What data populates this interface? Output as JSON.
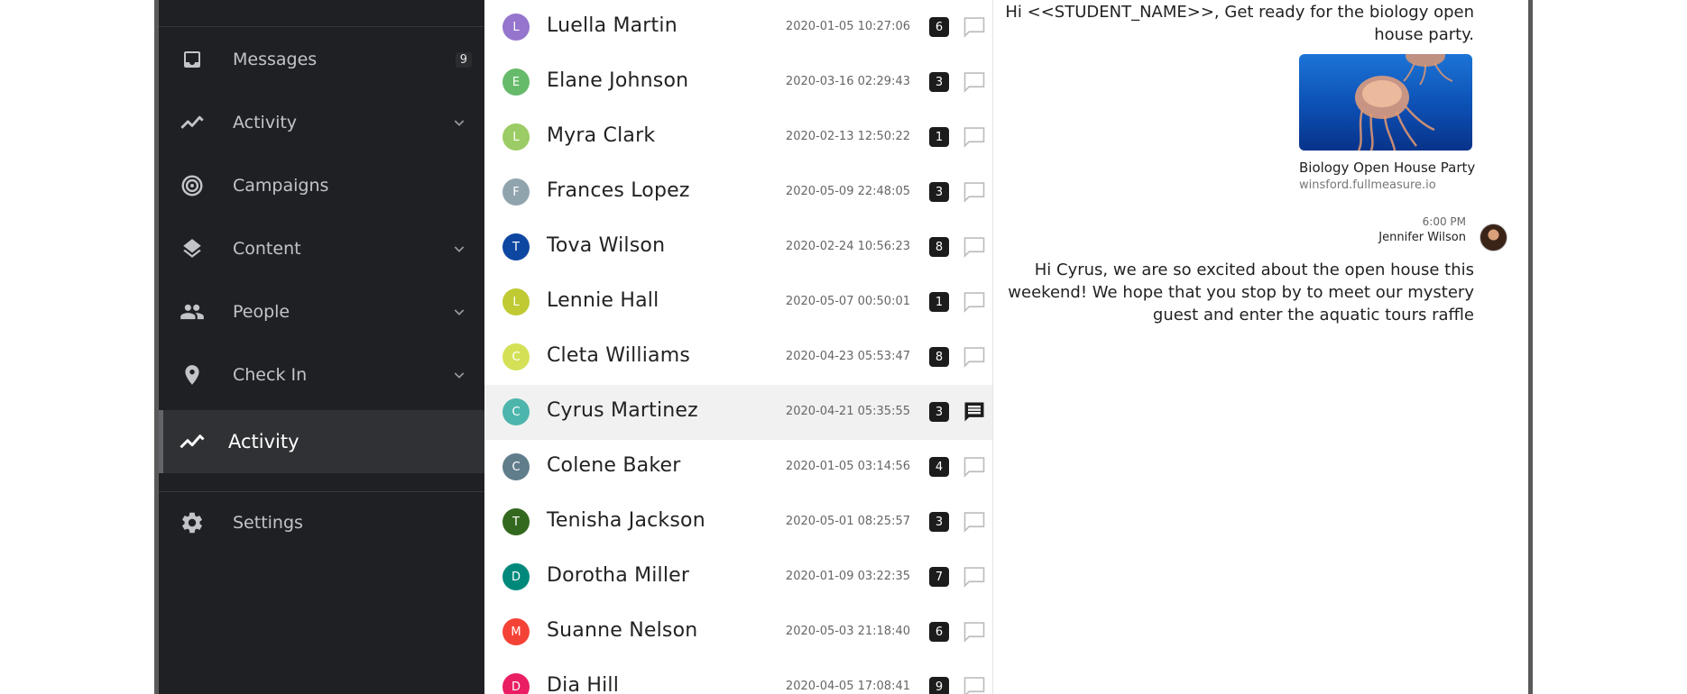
{
  "sidebar": {
    "items": [
      {
        "label": "Messages",
        "icon": "inbox-icon",
        "badge": "9"
      },
      {
        "label": "Activity",
        "icon": "activity-icon"
      },
      {
        "label": "Campaigns",
        "icon": "target-icon"
      },
      {
        "label": "Content",
        "icon": "layers-icon"
      },
      {
        "label": "People",
        "icon": "people-icon"
      },
      {
        "label": "Check In",
        "icon": "location-pin-icon"
      },
      {
        "label": "Activity",
        "icon": "activity-icon"
      },
      {
        "label": "Settings",
        "icon": "gear-icon"
      }
    ]
  },
  "contacts": [
    {
      "initial": "L",
      "name": "Luella Martin",
      "date": "2020-01-05 10:27:06",
      "count": "6",
      "color": "#9575cd"
    },
    {
      "initial": "E",
      "name": "Elane Johnson",
      "date": "2020-03-16 02:29:43",
      "count": "3",
      "color": "#66bb6a"
    },
    {
      "initial": "L",
      "name": "Myra Clark",
      "date": "2020-02-13 12:50:22",
      "count": "1",
      "color": "#9ccc65"
    },
    {
      "initial": "F",
      "name": "Frances Lopez",
      "date": "2020-05-09 22:48:05",
      "count": "3",
      "color": "#90a4ae"
    },
    {
      "initial": "T",
      "name": "Tova Wilson",
      "date": "2020-02-24 10:56:23",
      "count": "8",
      "color": "#0d47a1"
    },
    {
      "initial": "L",
      "name": "Lennie Hall",
      "date": "2020-05-07 00:50:01",
      "count": "1",
      "color": "#c0ca33"
    },
    {
      "initial": "C",
      "name": "Cleta Williams",
      "date": "2020-04-23 05:53:47",
      "count": "8",
      "color": "#d4e157"
    },
    {
      "initial": "C",
      "name": "Cyrus Martinez",
      "date": "2020-04-21 05:35:55",
      "count": "3",
      "color": "#4db6ac"
    },
    {
      "initial": "C",
      "name": "Colene Baker",
      "date": "2020-01-05 03:14:56",
      "count": "4",
      "color": "#607d8b"
    },
    {
      "initial": "T",
      "name": "Tenisha Jackson",
      "date": "2020-05-01 08:25:57",
      "count": "3",
      "color": "#33691e"
    },
    {
      "initial": "D",
      "name": "Dorotha Miller",
      "date": "2020-01-09 03:22:35",
      "count": "7",
      "color": "#00897b"
    },
    {
      "initial": "M",
      "name": "Suanne Nelson",
      "date": "2020-05-03 21:18:40",
      "count": "6",
      "color": "#f44336"
    },
    {
      "initial": "D",
      "name": "Dia Hill",
      "date": "2020-04-05 17:08:41",
      "count": "9",
      "color": "#e91e63"
    }
  ],
  "conversation": {
    "message1": "Hi <<STUDENT_NAME>>, Get ready for the biology open house party.",
    "link_title": "Biology Open House Party",
    "link_url": "winsford.fullmeasure.io",
    "time": "6:00 PM",
    "sender": "Jennifer Wilson",
    "message2": "Hi Cyrus, we are so excited about the open house this weekend! We hope that you stop by to meet our mystery guest and enter the aquatic tours raffle"
  }
}
